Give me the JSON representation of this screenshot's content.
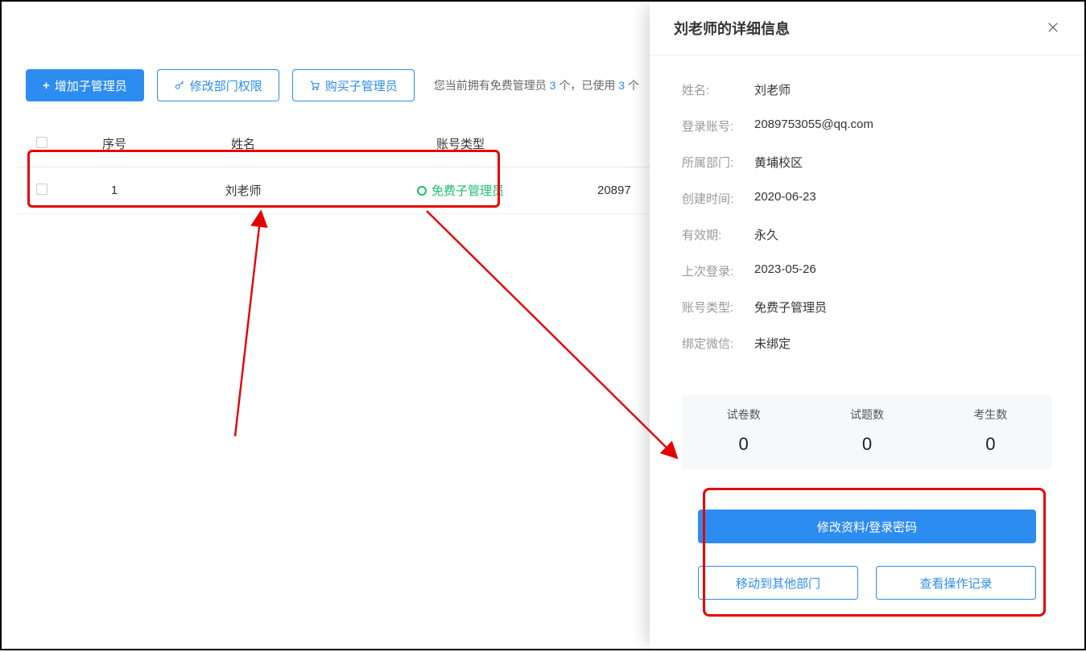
{
  "toolbar": {
    "add_label": "增加子管理员",
    "perm_label": "修改部门权限",
    "buy_label": "购买子管理员",
    "hint_prefix": "您当前拥有免费管理员 ",
    "hint_count": "3",
    "hint_mid": " 个，已使用 ",
    "hint_used": "3",
    "hint_suffix": " 个"
  },
  "table": {
    "headers": {
      "index": "序号",
      "name": "姓名",
      "acct_type": "账号类型"
    },
    "rows": [
      {
        "index": "1",
        "name": "刘老师",
        "acct_type": "免费子管理员",
        "account_partial": "20897"
      }
    ]
  },
  "drawer": {
    "title": "刘老师的详细信息",
    "labels": {
      "name": "姓名:",
      "account": "登录账号:",
      "dept": "所属部门:",
      "created": "创建时间:",
      "expiry": "有效期:",
      "last_login": "上次登录:",
      "acct_type": "账号类型:",
      "wechat": "绑定微信:"
    },
    "values": {
      "name": "刘老师",
      "account": "2089753055@qq.com",
      "dept": "黄埔校区",
      "created": "2020-06-23",
      "expiry": "永久",
      "last_login": "2023-05-26",
      "acct_type": "免费子管理员",
      "wechat": "未绑定"
    },
    "stats": {
      "papers_label": "试卷数",
      "questions_label": "试题数",
      "students_label": "考生数",
      "papers": "0",
      "questions": "0",
      "students": "0"
    },
    "actions": {
      "edit": "修改资料/登录密码",
      "move": "移动到其他部门",
      "log": "查看操作记录"
    }
  }
}
